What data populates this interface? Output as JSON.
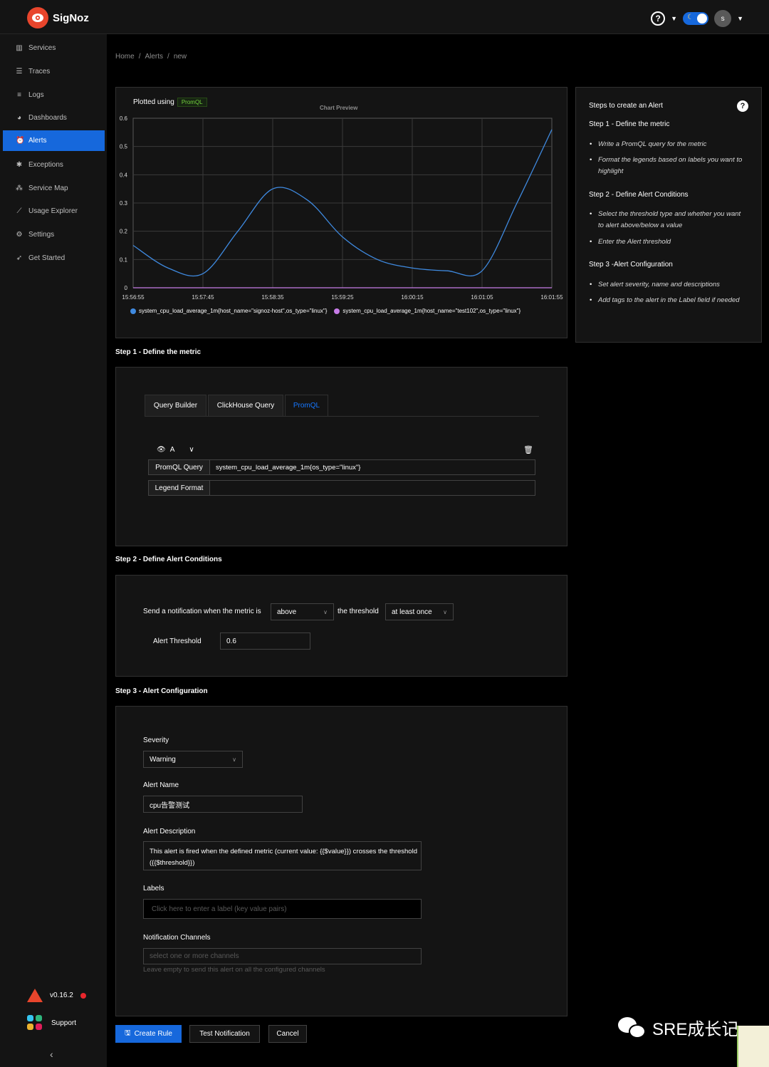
{
  "app": {
    "name": "SigNoz"
  },
  "header": {
    "help_icon": "question-circle-icon",
    "avatar_initial": "s"
  },
  "sidebar": {
    "items": [
      {
        "label": "Services",
        "icon": "bar-chart-icon"
      },
      {
        "label": "Traces",
        "icon": "menu-icon"
      },
      {
        "label": "Logs",
        "icon": "align-left-icon"
      },
      {
        "label": "Dashboards",
        "icon": "dashboard-icon"
      },
      {
        "label": "Alerts",
        "icon": "alarm-icon",
        "active": true
      },
      {
        "label": "Exceptions",
        "icon": "bug-icon"
      },
      {
        "label": "Service Map",
        "icon": "deployment-unit-icon"
      },
      {
        "label": "Usage Explorer",
        "icon": "line-chart-icon"
      },
      {
        "label": "Settings",
        "icon": "settings-icon"
      },
      {
        "label": "Get Started",
        "icon": "rocket-icon"
      }
    ],
    "version": "v0.16.2",
    "support": "Support"
  },
  "breadcrumb": [
    "Home",
    "Alerts",
    "new"
  ],
  "chart_panel": {
    "plotted_using": "Plotted using",
    "tag": "PromQL",
    "chart_title": "Chart Preview"
  },
  "chart_data": {
    "type": "line",
    "title": "Chart Preview",
    "x": [
      "15:56:55",
      "15:57:45",
      "15:58:35",
      "15:59:25",
      "16:00:15",
      "16:01:05",
      "16:01:55"
    ],
    "ylim": [
      0,
      0.6
    ],
    "yticks": [
      "0",
      "0.1",
      "0.2",
      "0.3",
      "0.4",
      "0.5",
      "0.6"
    ],
    "series": [
      {
        "name": "system_cpu_load_average_1m{host_name=\"signoz-host\",os_type=\"linux\"}",
        "color": "#3f8ae0",
        "points": [
          [
            0,
            0.15
          ],
          [
            0.5,
            0.07
          ],
          [
            1,
            0.05
          ],
          [
            1.5,
            0.2
          ],
          [
            2,
            0.35
          ],
          [
            2.5,
            0.31
          ],
          [
            3,
            0.18
          ],
          [
            3.5,
            0.1
          ],
          [
            4,
            0.07
          ],
          [
            4.5,
            0.06
          ],
          [
            5,
            0.06
          ],
          [
            5.5,
            0.3
          ],
          [
            6,
            0.56
          ]
        ]
      },
      {
        "name": "system_cpu_load_average_1m{host_name=\"test102\",os_type=\"linux\"}",
        "color": "#c77ce8",
        "points": [
          [
            0,
            0
          ],
          [
            6,
            0
          ]
        ]
      }
    ],
    "grid": true,
    "legend_position": "bottom"
  },
  "steps_panel": {
    "heading": "Steps to create an Alert",
    "step1_title": "Step 1 - Define the metric",
    "step1_items": [
      "Write a PromQL query for the metric",
      "Format the legends based on labels you want to highlight"
    ],
    "step2_title": "Step 2 - Define Alert Conditions",
    "step2_items": [
      "Select the threshold type and whether you want to alert above/below a value",
      "Enter the Alert threshold"
    ],
    "step3_title": "Step 3 -Alert Configuration",
    "step3_items": [
      "Set alert severity, name and descriptions",
      "Add tags to the alert in the Label field if needed"
    ]
  },
  "step1": {
    "title": "Step 1 - Define the metric",
    "tabs": [
      "Query Builder",
      "ClickHouse Query",
      "PromQL"
    ],
    "active_tab": "PromQL",
    "query_name": "A",
    "promql_label": "PromQL Query",
    "promql_value": "system_cpu_load_average_1m{os_type=\"linux\"}",
    "legend_label": "Legend Format",
    "legend_value": ""
  },
  "step2": {
    "title": "Step 2 - Define Alert Conditions",
    "sentence_prefix": "Send a notification when the metric is",
    "compare_op": "above",
    "threshold_text": "the threshold",
    "match_type": "at least once",
    "threshold_label": "Alert Threshold",
    "threshold_value": "0.6"
  },
  "step3": {
    "title": "Step 3 - Alert Configuration",
    "severity_label": "Severity",
    "severity_value": "Warning",
    "name_label": "Alert Name",
    "name_value": "cpu告警测试",
    "desc_label": "Alert Description",
    "desc_value": "This alert is fired when the defined metric (current value: {{$value}}) crosses the threshold ({{$threshold}})",
    "labels_label": "Labels",
    "labels_placeholder": "Click here to enter a label (key value pairs)",
    "channels_label": "Notification Channels",
    "channels_placeholder": "select one or more channels",
    "channels_hint": "Leave empty to send this alert on all the configured channels"
  },
  "actions": {
    "create": "Create Rule",
    "test": "Test Notification",
    "cancel": "Cancel"
  },
  "watermark": {
    "text": "SRE成长记"
  }
}
